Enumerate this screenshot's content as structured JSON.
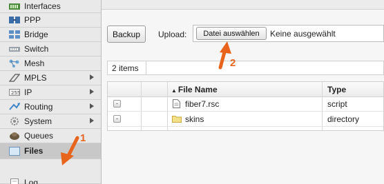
{
  "sidebar": {
    "items": [
      {
        "label": "Interfaces",
        "icon": "interfaces-icon",
        "has_submenu": false
      },
      {
        "label": "PPP",
        "icon": "ppp-icon",
        "has_submenu": false
      },
      {
        "label": "Bridge",
        "icon": "bridge-icon",
        "has_submenu": false
      },
      {
        "label": "Switch",
        "icon": "switch-icon",
        "has_submenu": false
      },
      {
        "label": "Mesh",
        "icon": "mesh-icon",
        "has_submenu": false
      },
      {
        "label": "MPLS",
        "icon": "mpls-icon",
        "has_submenu": true
      },
      {
        "label": "IP",
        "icon": "ip-icon",
        "has_submenu": true
      },
      {
        "label": "Routing",
        "icon": "routing-icon",
        "has_submenu": true
      },
      {
        "label": "System",
        "icon": "system-icon",
        "has_submenu": true
      },
      {
        "label": "Queues",
        "icon": "queues-icon",
        "has_submenu": false
      },
      {
        "label": "Files",
        "icon": "files-icon",
        "has_submenu": false,
        "selected": true
      },
      {
        "label": "Log",
        "icon": "log-icon",
        "has_submenu": false
      }
    ]
  },
  "toolbar": {
    "backup_label": "Backup",
    "upload_label": "Upload:",
    "choose_file_label": "Datei auswählen",
    "no_file_text": "Keine ausgewählt"
  },
  "list": {
    "count_text": "2 items",
    "columns": [
      "File Name",
      "Type"
    ],
    "rows": [
      {
        "name": "fiber7.rsc",
        "type": "script",
        "icon": "document-icon",
        "action": "-"
      },
      {
        "name": "skins",
        "type": "directory",
        "icon": "folder-icon",
        "action": "-"
      }
    ]
  },
  "annotations": {
    "one": "1",
    "two": "2",
    "color": "#e8631c"
  },
  "colors": {
    "sidebar_bg": "#e9e9e9",
    "selected_bg": "#c8c8c8",
    "accent_arrow": "#e8631c"
  }
}
